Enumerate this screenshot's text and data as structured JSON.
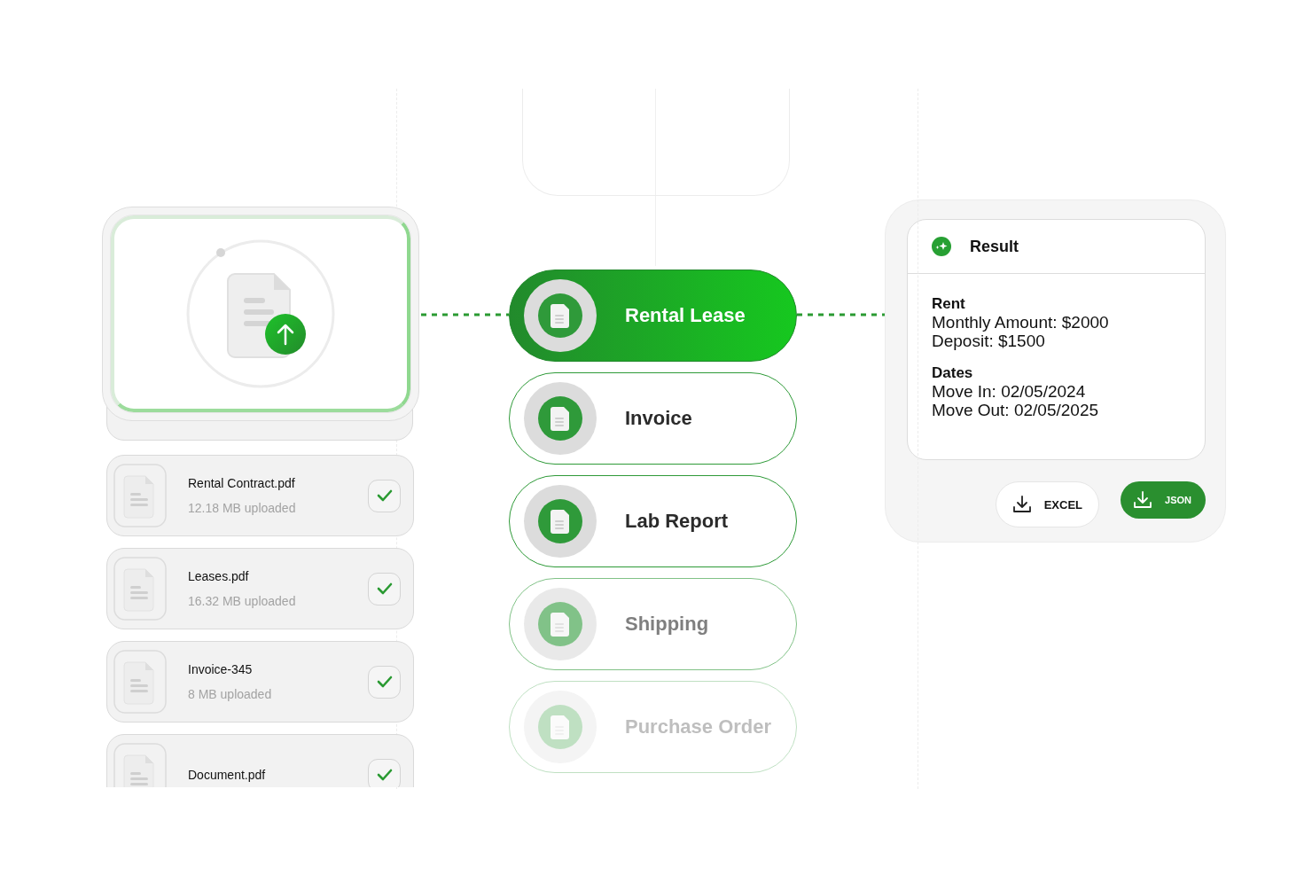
{
  "files": [
    {
      "name": "Rental Contract.pdf",
      "meta": "12.18 MB  uploaded",
      "checked": true
    },
    {
      "name": "Leases.pdf",
      "meta": "16.32 MB  uploaded",
      "checked": true
    },
    {
      "name": "Invoice-345",
      "meta": "8 MB  uploaded",
      "checked": true
    },
    {
      "name": "Document.pdf",
      "checked": true
    }
  ],
  "categories": [
    {
      "label": "Rental Lease",
      "selected": true,
      "dimmed": false,
      "faded": false
    },
    {
      "label": "Invoice",
      "selected": false,
      "dimmed": false,
      "faded": false
    },
    {
      "label": "Lab Report",
      "selected": false,
      "dimmed": false,
      "faded": false
    },
    {
      "label": "Shipping",
      "selected": false,
      "dimmed": true,
      "faded": false
    },
    {
      "label": "Purchase Order",
      "selected": false,
      "dimmed": false,
      "faded": true
    }
  ],
  "result": {
    "title": "Result",
    "sections": [
      {
        "heading": "Rent",
        "lines": [
          "Monthly Amount: $2000",
          "Deposit: $1500"
        ]
      },
      {
        "heading": "Dates",
        "lines": [
          "Move In: 02/05/2024",
          "Move Out: 02/05/2025"
        ]
      }
    ],
    "buttons": [
      {
        "label": "EXCEL",
        "primary": false
      },
      {
        "label": "JSON",
        "primary": true
      }
    ]
  }
}
